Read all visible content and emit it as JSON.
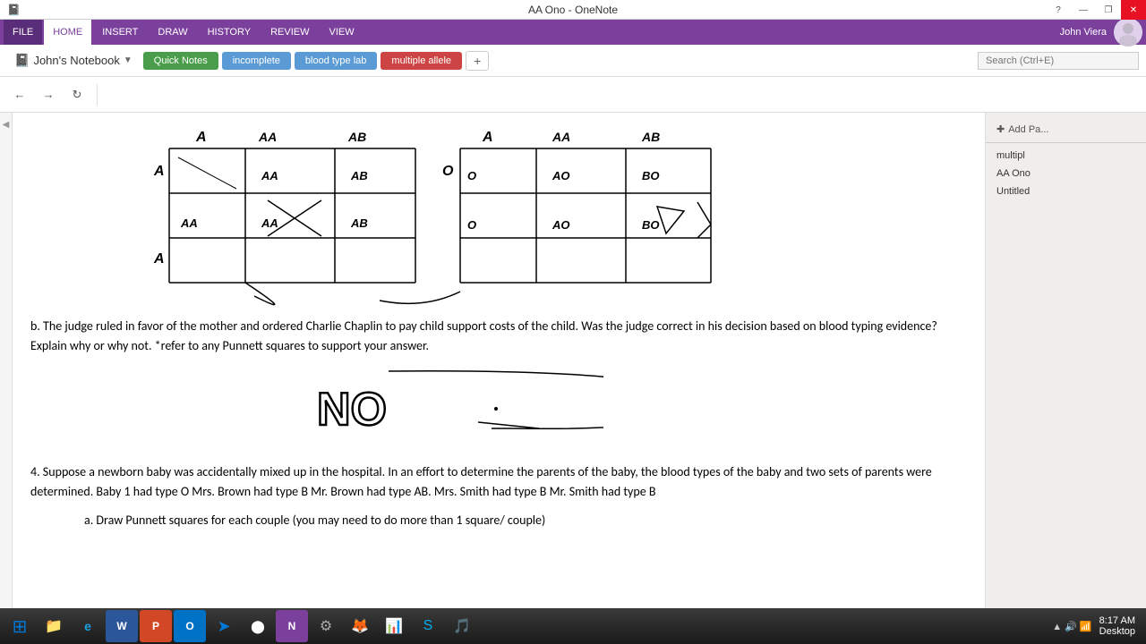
{
  "titlebar": {
    "title": "AA Ono - OneNote",
    "controls": [
      "minimize",
      "restore",
      "close"
    ]
  },
  "ribbon": {
    "file": "FILE",
    "tabs": [
      "HOME",
      "INSERT",
      "DRAW",
      "HISTORY",
      "REVIEW",
      "VIEW"
    ]
  },
  "notebook": {
    "name": "John's Notebook",
    "tabs": [
      {
        "label": "Quick Notes",
        "color": "quick"
      },
      {
        "label": "incomplete",
        "color": "incomplete"
      },
      {
        "label": "blood type lab",
        "color": "blood"
      },
      {
        "label": "multiple allele",
        "color": "multiple",
        "active": true
      }
    ],
    "add_tab": "+",
    "user": "John Viera",
    "search_placeholder": "Search (Ctrl+E)"
  },
  "right_sidebar": {
    "add_page": "Add Pa...",
    "items": [
      {
        "label": "multipl"
      },
      {
        "label": "AA Ono"
      },
      {
        "label": "Untitled"
      }
    ]
  },
  "content": {
    "question_b_text": "b. The judge ruled in favor of the mother and ordered Charlie Chaplin to pay child support costs of the child. Was the judge correct in his decision based on blood typing evidence? Explain why or why not. *refer to any Punnett squares to support your answer.",
    "answer_no": "NO",
    "question_4_text": "4. Suppose a newborn baby was accidentally mixed up in the hospital. In an effort to determine the parents of the baby, the blood types of the baby and two sets of parents were determined. Baby 1 had type O Mrs. Brown had type B Mr. Brown had type AB.  Mrs. Smith had type B Mr. Smith had type B",
    "question_4a_text": "a. Draw Punnett squares for each couple (you may need to do more than 1 square/ couple)"
  },
  "taskbar": {
    "time": "8:17 AM",
    "date": "Desktop",
    "icons": [
      "⊞",
      "📁",
      "⬛",
      "e",
      "W",
      "P",
      "O",
      "➤",
      "●",
      "◈",
      "❋",
      "⚡",
      "S",
      "🎵"
    ]
  }
}
